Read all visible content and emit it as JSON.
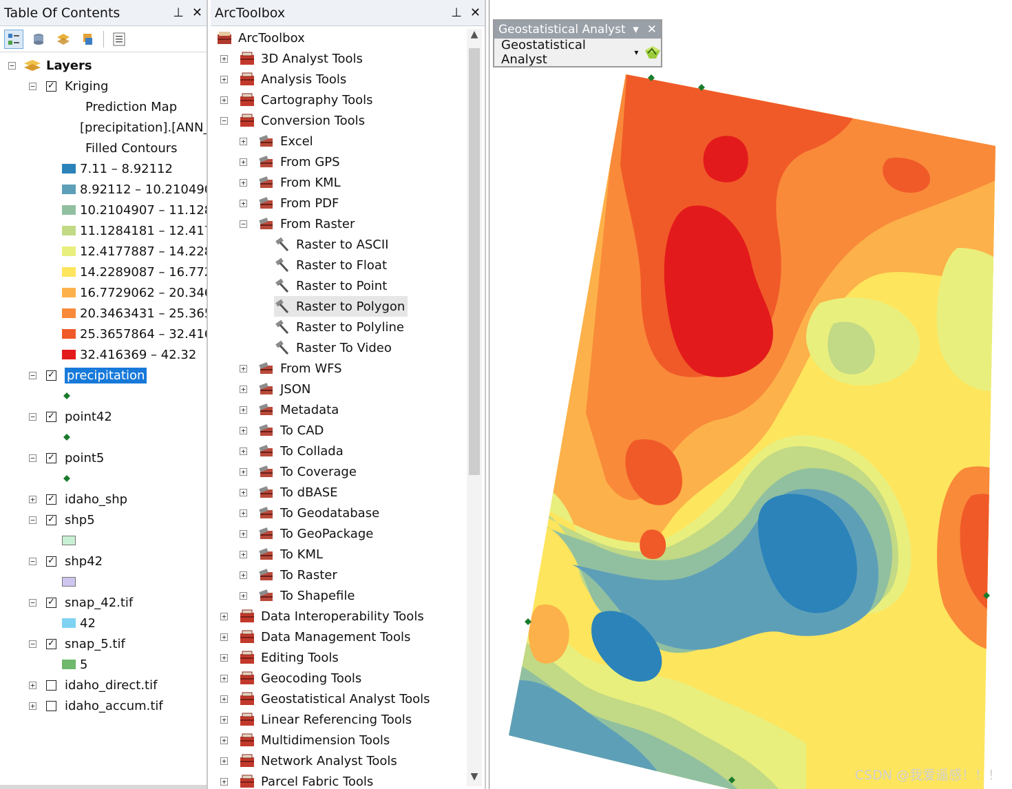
{
  "toc": {
    "title": "Table Of Contents",
    "pin_label": "⊥",
    "close_label": "✕",
    "layers_root": "Layers",
    "kriging": {
      "name": "Kriging",
      "sub1": "Prediction Map",
      "sub2": "[precipitation].[ANN_",
      "sub3": "Filled Contours",
      "legend": [
        {
          "label": "7.11 – 8.92112",
          "color": "#2b83ba"
        },
        {
          "label": "8.92112 – 10.210490",
          "color": "#5e9fb8"
        },
        {
          "label": "10.2104907 – 11.128",
          "color": "#91c0a0"
        },
        {
          "label": "11.1284181 – 12.417",
          "color": "#c2d985"
        },
        {
          "label": "12.4177887 – 14.228",
          "color": "#e9ef7d"
        },
        {
          "label": "14.2289087 – 16.772",
          "color": "#fde55d"
        },
        {
          "label": "16.7729062 – 20.346",
          "color": "#fdb14a"
        },
        {
          "label": "20.3463431 – 25.365",
          "color": "#f98a3a"
        },
        {
          "label": "25.3657864 – 32.416",
          "color": "#f05a28"
        },
        {
          "label": "32.416369 – 42.32",
          "color": "#e31a1c"
        }
      ]
    },
    "precipitation": "precipitation",
    "point42": "point42",
    "point5": "point5",
    "idaho_shp": "idaho_shp",
    "shp5": "shp5",
    "shp42": "shp42",
    "snap42": "snap_42.tif",
    "snap42_value": "42",
    "snap5": "snap_5.tif",
    "snap5_value": "5",
    "idaho_direct": "idaho_direct.tif",
    "idaho_accum": "idaho_accum.tif",
    "colors": {
      "shp5": "#c9f0d4",
      "shp42": "#cfc6ef",
      "snap42": "#7fd3f2",
      "snap5": "#6fb86c",
      "point": "#1b7b2d"
    }
  },
  "toolbox": {
    "title": "ArcToolbox",
    "root": "ArcToolbox",
    "top_tools": [
      "3D Analyst Tools",
      "Analysis Tools",
      "Cartography Tools",
      "Conversion Tools"
    ],
    "conversion_children_a": [
      "Excel",
      "From GPS",
      "From KML",
      "From PDF",
      "From Raster"
    ],
    "from_raster_tools": [
      "Raster to ASCII",
      "Raster to Float",
      "Raster to Point",
      "Raster to Polygon",
      "Raster to Polyline",
      "Raster To Video"
    ],
    "conversion_children_b": [
      "From WFS",
      "JSON",
      "Metadata",
      "To CAD",
      "To Collada",
      "To Coverage",
      "To dBASE",
      "To Geodatabase",
      "To GeoPackage",
      "To KML",
      "To Raster",
      "To Shapefile"
    ],
    "bottom_tools": [
      "Data Interoperability Tools",
      "Data Management Tools",
      "Editing Tools",
      "Geocoding Tools",
      "Geostatistical Analyst Tools",
      "Linear Referencing Tools",
      "Multidimension Tools",
      "Network Analyst Tools",
      "Parcel Fabric Tools"
    ]
  },
  "geostat_toolbar": {
    "title": "Geostatistical Analyst",
    "menu": "Geostatistical Analyst"
  },
  "map": {
    "watermark": "CSDN @我爱遥感！！！"
  }
}
